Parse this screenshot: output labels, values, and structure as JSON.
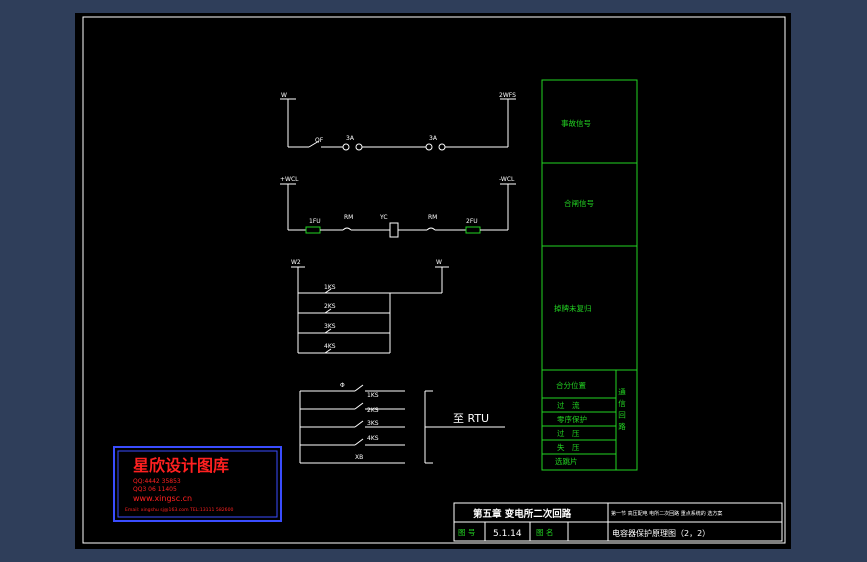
{
  "circuit1": {
    "left_bus": "W",
    "right_bus": "2WFS",
    "switch": "QF",
    "fuse_a": "3A",
    "fuse_b": "3A"
  },
  "circuit2": {
    "left_bus": "+WCL",
    "right_bus": "-WCL",
    "fuse_left": "1FU",
    "contact_left": "RM",
    "coil": "YC",
    "contact_right": "RM",
    "fuse_right": "2FU"
  },
  "circuit3": {
    "left_bus": "W2",
    "right_bus": "W",
    "contacts": [
      "1KS",
      "2KS",
      "3KS",
      "4KS"
    ]
  },
  "circuit4": {
    "top_label": "Φ",
    "contacts": [
      "1KS",
      "2KS",
      "3KS",
      "4KS",
      "XB"
    ],
    "rtu_label": "至 RTU"
  },
  "legend": {
    "items": [
      "事故信号",
      "合闸信号",
      "掉牌未复归",
      "合分位置"
    ],
    "sub_items": [
      "过　流",
      "零序保护",
      "过　压",
      "失　压",
      "选跳片"
    ],
    "group_label": "通信回路"
  },
  "watermark": {
    "title": "星欣设计图库",
    "line1": "QQ:4442 35853",
    "line2": "QQ3 06 11405",
    "website": "www.xingsc.cn",
    "email": "Email: xingshu sj@163.com  TEL:13111 582600"
  },
  "title_block": {
    "chapter": "第五章  变电所二次回路",
    "section": "第一节  高压配电 电所二次回路 重点系统的 选方案",
    "drawing_no_label": "图 号",
    "drawing_no": "5.1.14",
    "drawing_name_label": "图 名",
    "drawing_name": "电容器保护原理图（2，2）"
  }
}
